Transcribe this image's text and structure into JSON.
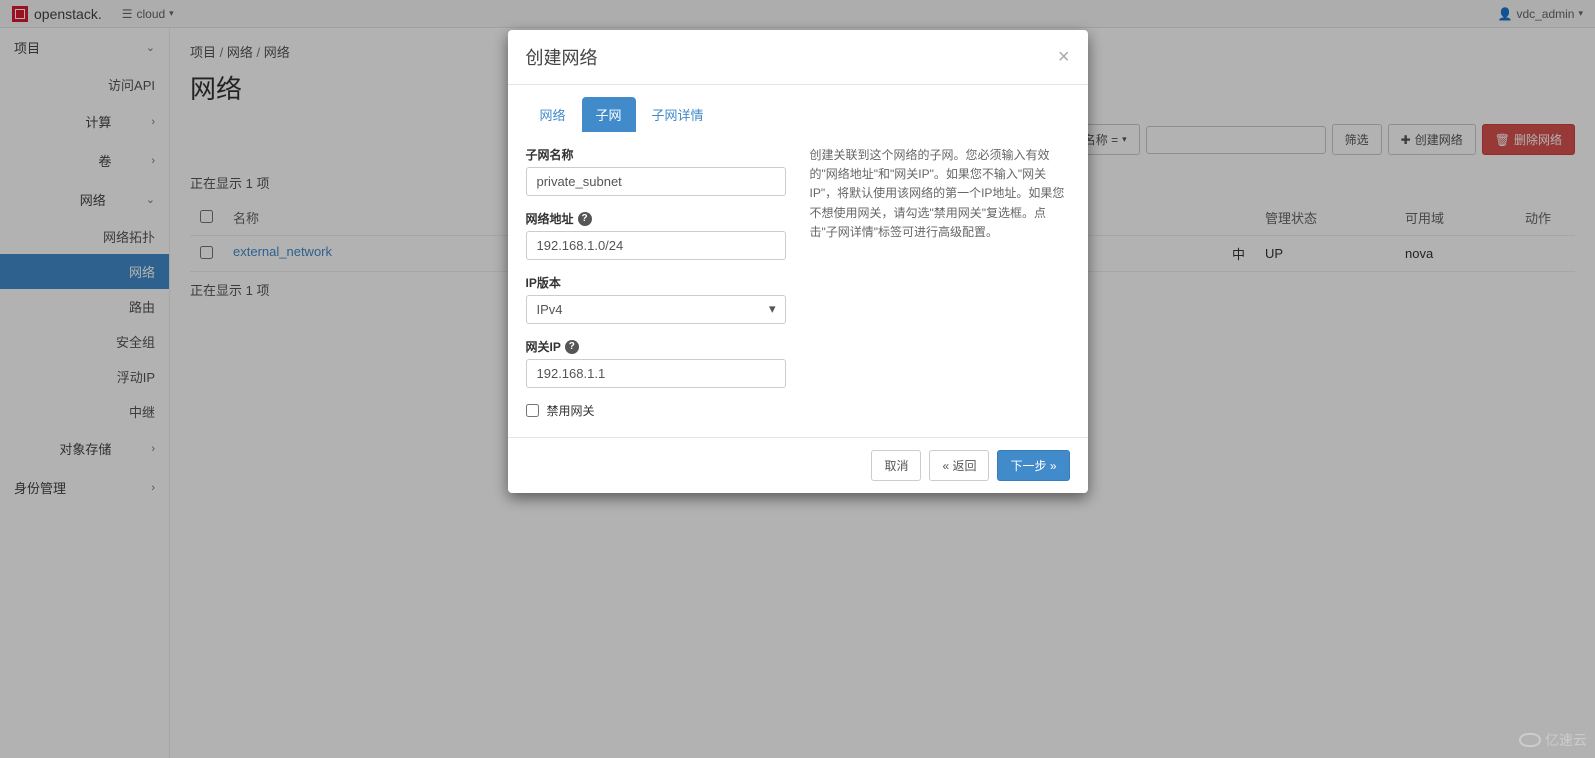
{
  "topbar": {
    "brand": "openstack.",
    "cloud_label": "cloud",
    "user_label": "vdc_admin"
  },
  "sidebar": {
    "project": "项目",
    "access_api": "访问API",
    "compute": "计算",
    "volumes": "卷",
    "network": "网络",
    "subitems": {
      "topology": "网络拓扑",
      "networks": "网络",
      "routers": "路由",
      "security_groups": "安全组",
      "floating_ips": "浮动IP",
      "relay": "中继"
    },
    "object_storage": "对象存储",
    "identity": "身份管理"
  },
  "page": {
    "breadcrumb_project": "项目",
    "breadcrumb_network": "网络",
    "breadcrumb_current": "网络",
    "title": "网络",
    "showing_items": "正在显示 1 项",
    "toolbar": {
      "name_filter": "名称 =",
      "filter": "筛选",
      "create_network": "创建网络",
      "delete_networks": "删除网络"
    },
    "table": {
      "headers": {
        "name": "名称",
        "admin_state": "管理状态",
        "availability_zone": "可用域",
        "actions": "动作"
      },
      "rows": [
        {
          "name": "external_network",
          "status_suffix": "中",
          "admin_state": "UP",
          "zone": "nova"
        }
      ]
    }
  },
  "modal": {
    "title": "创建网络",
    "tabs": {
      "network": "网络",
      "subnet": "子网",
      "subnet_detail": "子网详情"
    },
    "form": {
      "subnet_name_label": "子网名称",
      "subnet_name_value": "private_subnet",
      "network_address_label": "网络地址",
      "network_address_value": "192.168.1.0/24",
      "ip_version_label": "IP版本",
      "ip_version_value": "IPv4",
      "gateway_ip_label": "网关IP",
      "gateway_ip_value": "192.168.1.1",
      "disable_gateway_label": "禁用网关"
    },
    "help_text": "创建关联到这个网络的子网。您必须输入有效的\"网络地址\"和\"网关IP\"。如果您不输入\"网关IP\"，将默认使用该网络的第一个IP地址。如果您不想使用网关，请勾选\"禁用网关\"复选框。点击\"子网详情\"标签可进行高级配置。",
    "footer": {
      "cancel": "取消",
      "back": "« 返回",
      "next": "下一步 »"
    }
  },
  "watermark": "亿速云"
}
